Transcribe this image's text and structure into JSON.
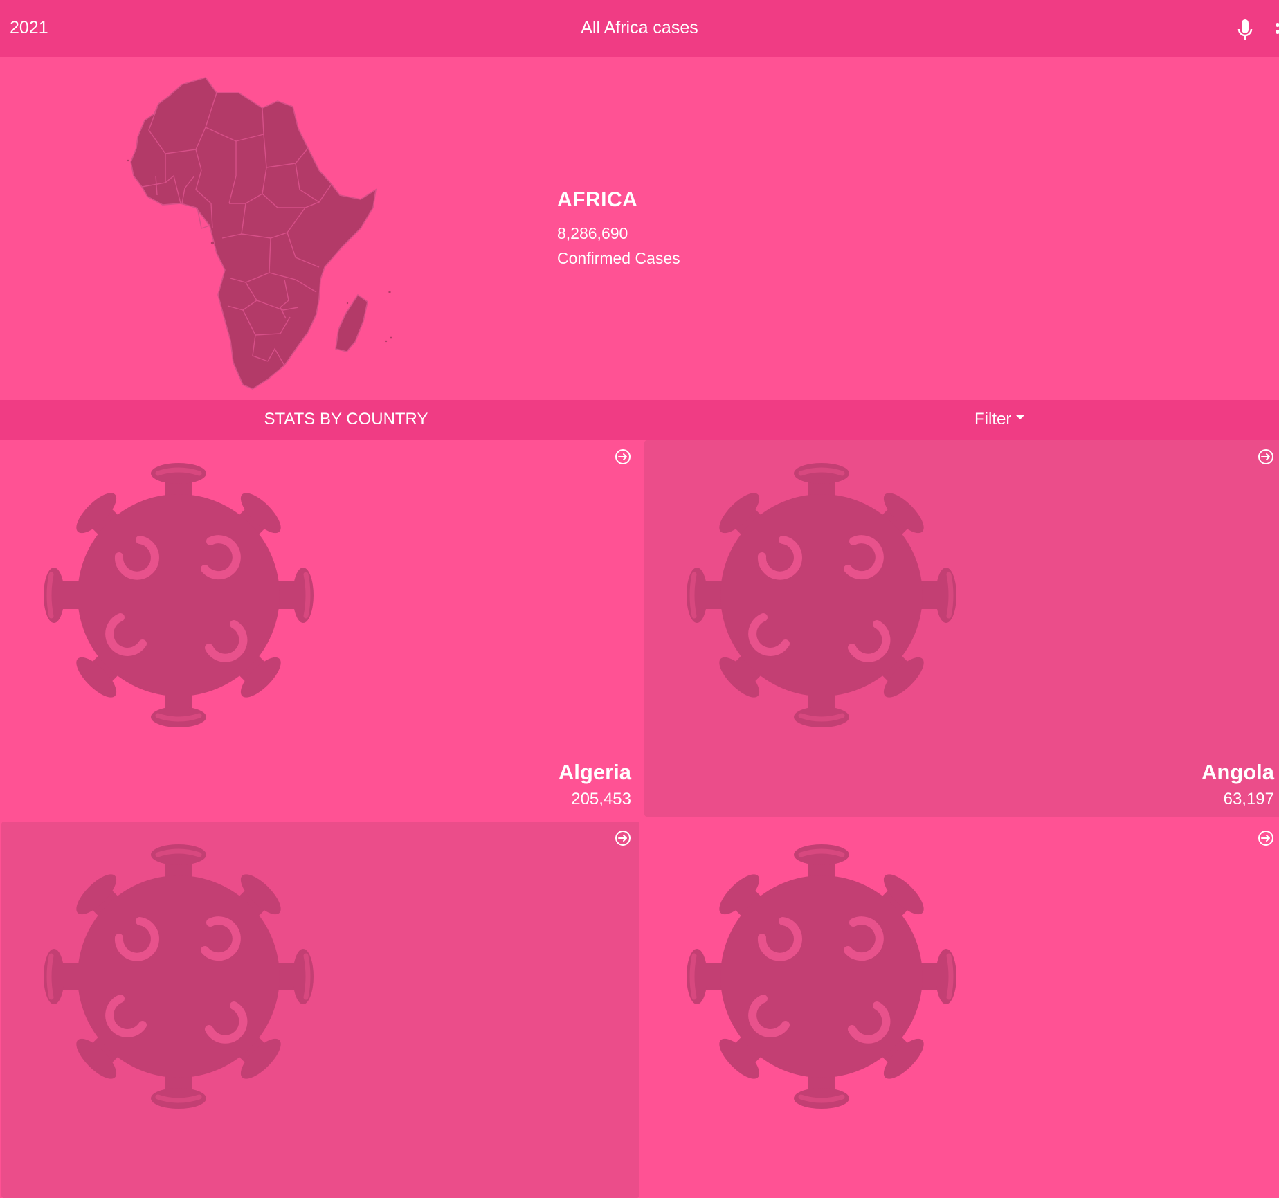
{
  "header": {
    "year": "2021",
    "title": "All Africa cases",
    "icons": [
      "microphone-icon",
      "more-icon"
    ]
  },
  "summary": {
    "region": "AFRICA",
    "cases": "8,286,690",
    "cases_label": "Confirmed Cases",
    "map_icon": "africa-map"
  },
  "stats": {
    "title": "STATS BY COUNTRY",
    "filter_label": "Filter"
  },
  "countries": [
    {
      "name": "Algeria",
      "cases": "205,453",
      "icon": "virus-icon"
    },
    {
      "name": "Angola",
      "cases": "63,197",
      "icon": "virus-icon"
    },
    {
      "name": "",
      "cases": "",
      "icon": "virus-icon"
    },
    {
      "name": "",
      "cases": "",
      "icon": "virus-icon"
    }
  ],
  "colors": {
    "background": "#ff5294",
    "bar": "#f03c84",
    "card_alt": "#eb4d8a",
    "shape": "#b33a68",
    "text": "#ffffff"
  }
}
